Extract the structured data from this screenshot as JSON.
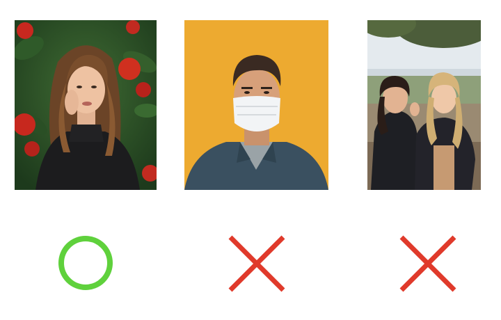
{
  "photos": [
    {
      "subject": "woman-with-flowers",
      "verdict": "ok"
    },
    {
      "subject": "man-with-face-mask",
      "verdict": "ng"
    },
    {
      "subject": "two-people-group",
      "verdict": "ng"
    }
  ],
  "icons": {
    "ok": "circle-icon",
    "ng": "cross-icon"
  },
  "colors": {
    "ok": "#5fd13c",
    "ng": "#e03a2b",
    "background": "#ffffff"
  }
}
